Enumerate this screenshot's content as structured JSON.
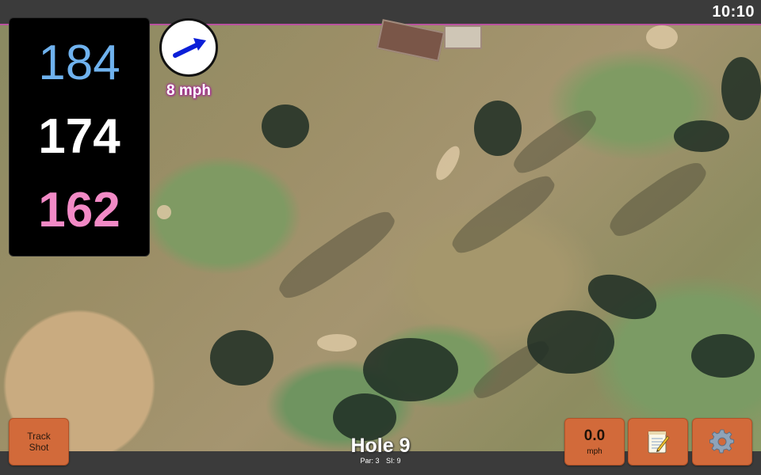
{
  "status_bar": {
    "time": "10:10"
  },
  "distances": {
    "back": "184",
    "middle": "174",
    "front": "162"
  },
  "wind": {
    "speed_label": "8 mph",
    "arrow_icon": "wind-direction-arrow-icon",
    "arrow_color": "#0b1fd8"
  },
  "buttons": {
    "track_shot_line1": "Track",
    "track_shot_line2": "Shot",
    "speed_value": "0.0",
    "speed_unit": "mph",
    "notes_icon": "notepad-icon",
    "settings_icon": "gear-icon"
  },
  "hole": {
    "title": "Hole 9",
    "par": "Par: 3",
    "si": "SI: 9"
  },
  "colors": {
    "accent": "#d26a3a",
    "back_distance": "#6fb2ee",
    "middle_distance": "#ffffff",
    "front_distance": "#f28ac6",
    "map_border": "#b9529f"
  }
}
